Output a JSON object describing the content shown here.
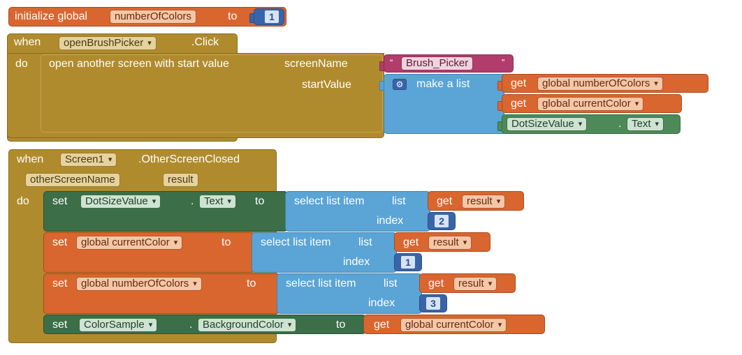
{
  "block1": {
    "kw": "initialize global",
    "var": "numberOfColors",
    "to": "to",
    "value": "1"
  },
  "block2": {
    "when": "when",
    "component": "openBrushPicker",
    "event": ".Click",
    "do": "do",
    "action": "open another screen with start value",
    "screen_name_label": "screenName",
    "screen_name_value": "Brush_Picker",
    "start_value_label": "startValue",
    "make_list": "make a list",
    "get_kw": "get",
    "item1": "global numberOfColors",
    "item2": "global currentColor",
    "item3_comp": "DotSizeValue",
    "item3_dot": ".",
    "item3_prop": "Text"
  },
  "block3": {
    "when": "when",
    "component": "Screen1",
    "event": ".OtherScreenClosed",
    "param1": "otherScreenName",
    "param2": "result",
    "do": "do",
    "set_kw": "set",
    "to_kw": "to",
    "get_kw": "get",
    "dot": ".",
    "select_label": "select list item",
    "list_label": "list",
    "index_label": "index",
    "s1_comp": "DotSizeValue",
    "s1_prop": "Text",
    "s1_get": "result",
    "s1_index": "2",
    "s2_var": "global currentColor",
    "s2_get": "result",
    "s2_index": "1",
    "s3_var": "global numberOfColors",
    "s3_get": "result",
    "s3_index": "3",
    "s4_comp": "ColorSample",
    "s4_prop": "BackgroundColor",
    "s4_get": "global currentColor"
  }
}
